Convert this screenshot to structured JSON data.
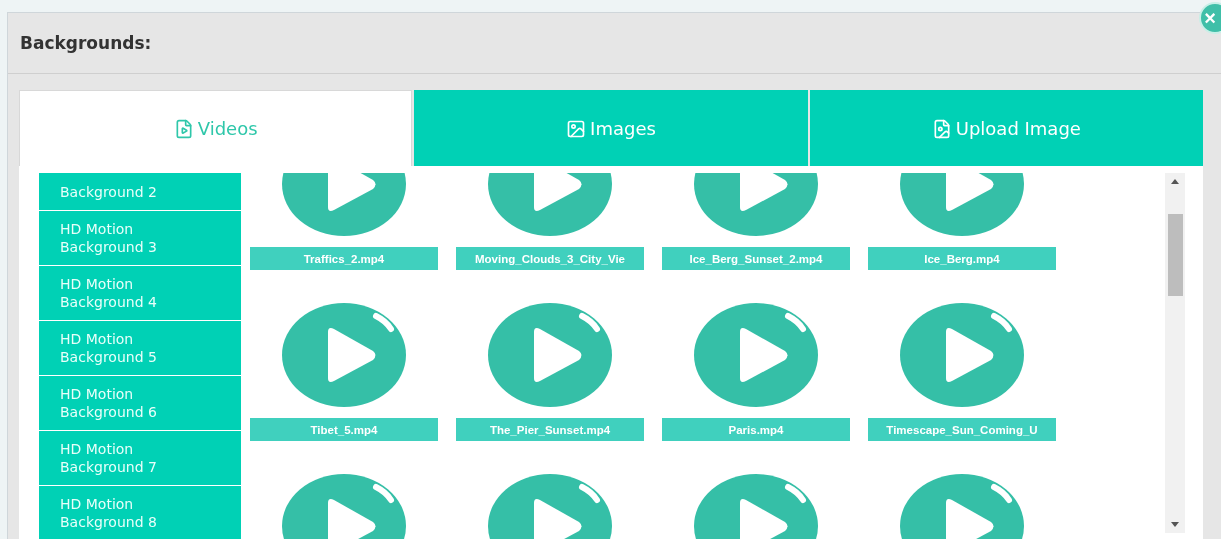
{
  "dialog": {
    "title": "Backgrounds:",
    "close": "×"
  },
  "tabs": [
    {
      "label": "Videos",
      "kind": "video",
      "selected": true
    },
    {
      "label": "Images",
      "kind": "image",
      "selected": false
    },
    {
      "label": "Upload Image",
      "kind": "upload",
      "selected": false
    }
  ],
  "sidebar": {
    "items": [
      {
        "label": "Background 2"
      },
      {
        "label": "HD Motion Background 3"
      },
      {
        "label": "HD Motion Background 4"
      },
      {
        "label": "HD Motion Background 5"
      },
      {
        "label": "HD Motion Background 6"
      },
      {
        "label": "HD Motion Background 7"
      },
      {
        "label": "HD Motion Background 8"
      }
    ]
  },
  "videos": [
    {
      "kind": "video",
      "name": "Traffics_2.mp4"
    },
    {
      "kind": "video",
      "name": "Moving_Clouds_3_City_Vie"
    },
    {
      "kind": "video",
      "name": "Ice_Berg_Sunset_2.mp4"
    },
    {
      "kind": "video",
      "name": "Ice_Berg.mp4"
    },
    {
      "kind": "video",
      "name": "Tibet_5.mp4"
    },
    {
      "kind": "video",
      "name": "The_Pier_Sunset.mp4"
    },
    {
      "kind": "video",
      "name": "Paris.mp4"
    },
    {
      "kind": "video",
      "name": "Timescape_Sun_Coming_U"
    },
    {
      "kind": "partial"
    },
    {
      "kind": "partial"
    },
    {
      "kind": "partial"
    },
    {
      "kind": "partial"
    }
  ]
}
